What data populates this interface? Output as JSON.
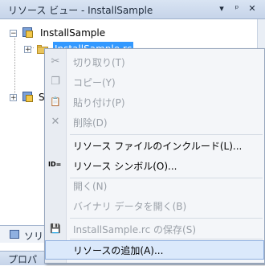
{
  "panel": {
    "title": "リソース ビュー - InstallSample",
    "controls": [
      "▾",
      "ᵖ",
      "✕"
    ]
  },
  "tree": {
    "root_label": "InstallSample",
    "child_label": "InstallSample.rc",
    "partial_item_1": "",
    "partial_item_2": "S"
  },
  "context_menu": {
    "items": [
      {
        "label": "切り取り(T)",
        "icon": "scissors-icon",
        "glyph": "✂",
        "enabled": false
      },
      {
        "label": "コピー(Y)",
        "icon": "copy-icon",
        "glyph": "❐",
        "enabled": false
      },
      {
        "label": "貼り付け(P)",
        "icon": "paste-icon",
        "glyph": "📋",
        "enabled": false
      },
      {
        "label": "削除(D)",
        "icon": "delete-icon",
        "glyph": "✕",
        "enabled": false
      },
      {
        "label": "リソース ファイルのインクルード(L)...",
        "icon": "",
        "enabled": true
      },
      {
        "label": "リソース シンボル(O)...",
        "icon": "id-icon",
        "glyph": "ID=",
        "enabled": true
      },
      {
        "label": "開く(N)",
        "icon": "",
        "enabled": false
      },
      {
        "label": "バイナリ データを開く(B)",
        "icon": "",
        "enabled": false
      },
      {
        "label": "InstallSample.rc の保存(S)",
        "icon": "save-icon",
        "glyph": "💾",
        "enabled": false
      },
      {
        "label": "リソースの追加(A)...",
        "icon": "",
        "enabled": true,
        "highlighted": true
      }
    ]
  },
  "bottom_tabs": {
    "tab1_label": "ソリ",
    "tab2_label": "プロパ"
  },
  "colors": {
    "selection": "#3399ff",
    "menu_background": "#f4f6f9",
    "hover_background": "#dbe9fb",
    "disabled_text": "#9aa0a8"
  }
}
